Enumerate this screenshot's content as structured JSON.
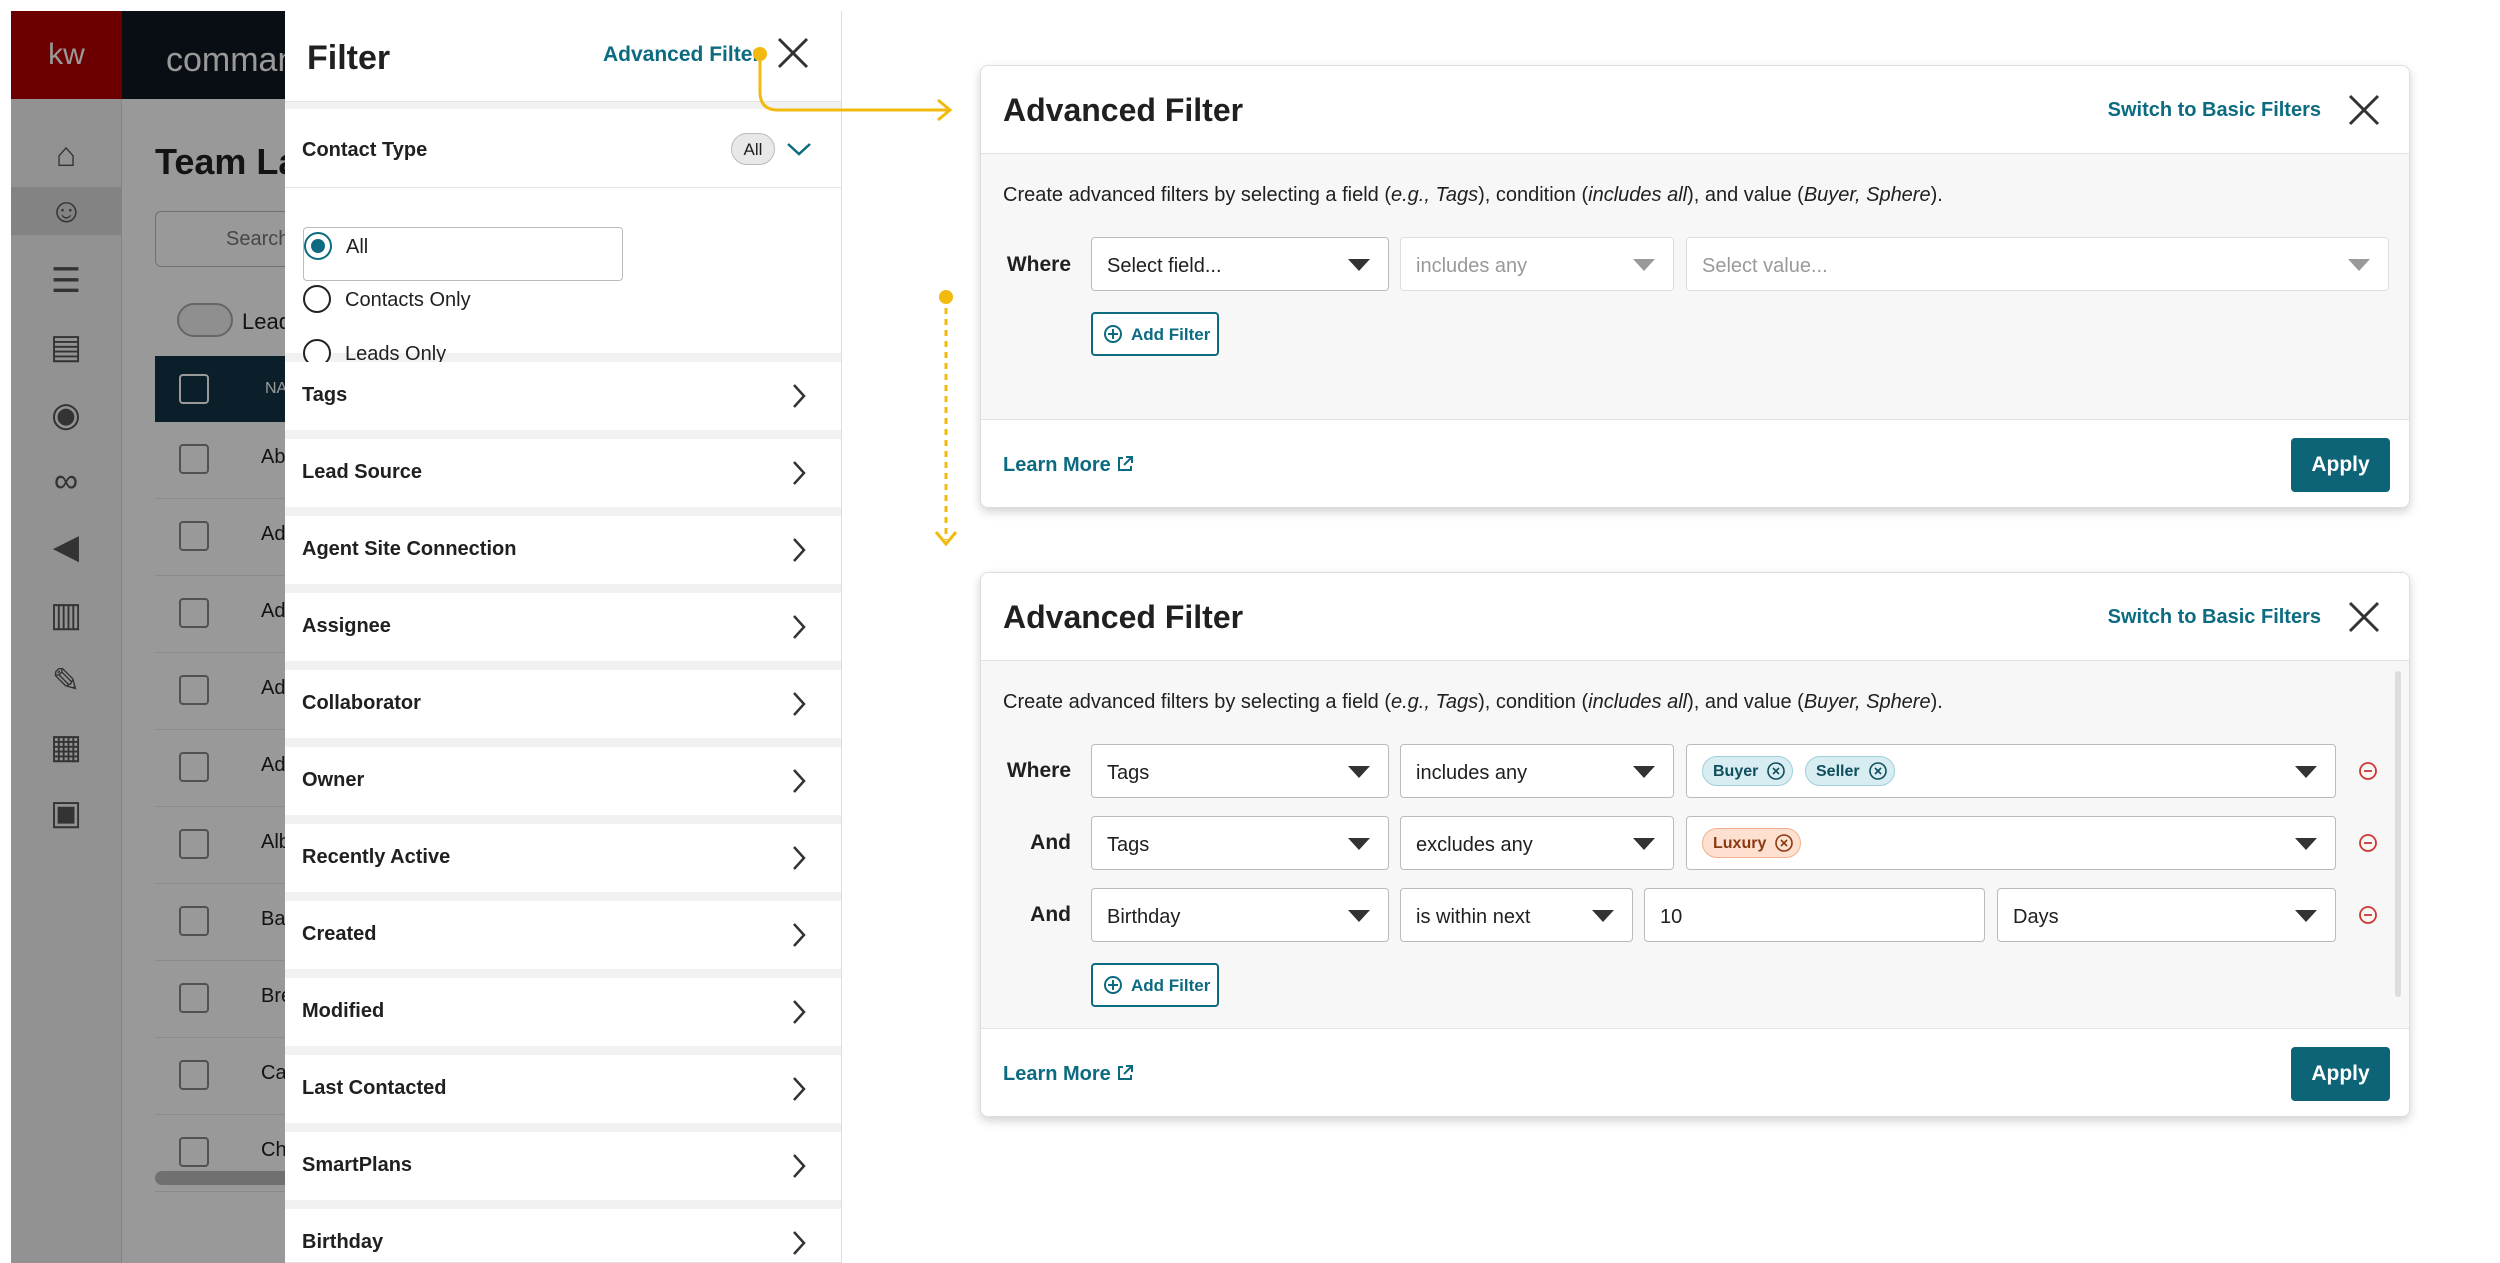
{
  "background_app": {
    "logo": "kw",
    "brand": "command",
    "page_title": "Team La",
    "search_placeholder": "Search",
    "toggle_label": "Lead",
    "table_header": "NA",
    "row_names": [
      "Ab",
      "Ad",
      "Ad",
      "Ad",
      "Ad",
      "Alb",
      "Ba",
      "Bre",
      "Ca",
      "Ch"
    ]
  },
  "filter_panel": {
    "title": "Filter",
    "advanced_link": "Advanced Filter",
    "contact_type": {
      "label": "Contact Type",
      "badge": "All",
      "options": [
        "All",
        "Contacts Only",
        "Leads Only"
      ],
      "selected": "All"
    },
    "sections": [
      "Tags",
      "Lead Source",
      "Agent Site Connection",
      "Assignee",
      "Collaborator",
      "Owner",
      "Recently Active",
      "Created",
      "Modified",
      "Last Contacted",
      "SmartPlans",
      "Birthday"
    ]
  },
  "advanced_empty": {
    "title": "Advanced Filter",
    "switch_link": "Switch to Basic Filters",
    "description_parts": [
      "Create advanced filters by selecting a field (",
      "e.g., Tags",
      "), condition (",
      "includes all",
      "), and value (",
      "Buyer, Sphere",
      ")."
    ],
    "where_label": "Where",
    "field_placeholder": "Select field...",
    "condition": "includes any",
    "value_placeholder": "Select value...",
    "add_filter": "Add Filter",
    "learn_more": "Learn More",
    "apply": "Apply"
  },
  "advanced_filled": {
    "title": "Advanced Filter",
    "switch_link": "Switch to Basic Filters",
    "description_parts": [
      "Create advanced filters by selecting a field (",
      "e.g., Tags",
      "), condition (",
      "includes all",
      "), and value (",
      "Buyer, Sphere",
      ")."
    ],
    "rows": [
      {
        "label": "Where",
        "field": "Tags",
        "condition": "includes any",
        "chips": [
          "Buyer",
          "Seller"
        ]
      },
      {
        "label": "And",
        "field": "Tags",
        "condition": "excludes any",
        "chips": [
          "Luxury"
        ]
      },
      {
        "label": "And",
        "field": "Birthday",
        "condition": "is within next",
        "value": "10",
        "unit": "Days"
      }
    ],
    "add_filter": "Add Filter",
    "learn_more": "Learn More",
    "apply": "Apply"
  },
  "colors": {
    "accent": "#0c6b80",
    "apply_bg": "#0c6476",
    "connector": "#f2b90f",
    "remove": "#d0352f",
    "brand_red": "#b40101"
  }
}
